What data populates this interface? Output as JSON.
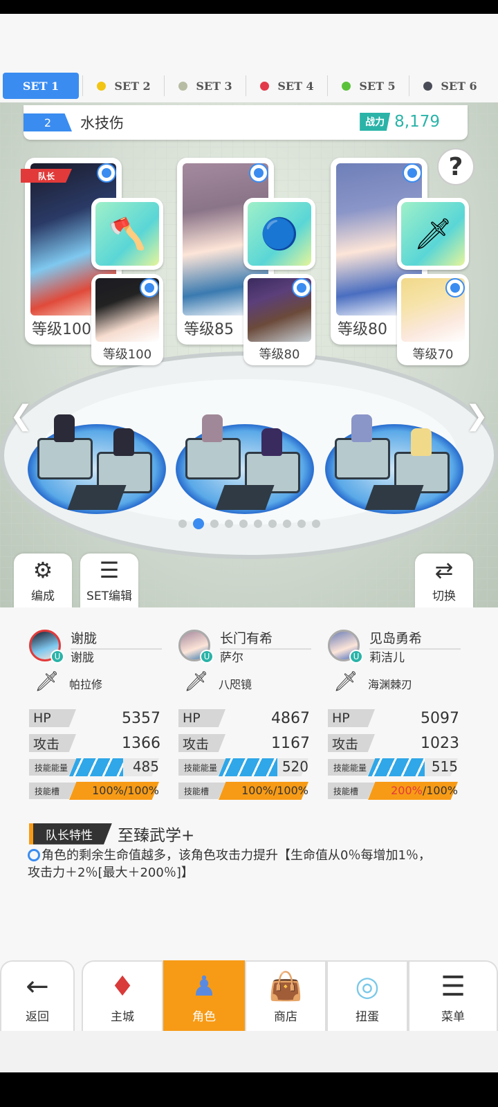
{
  "tabs": [
    {
      "label": "SET 1",
      "dot": null,
      "active": true
    },
    {
      "label": "SET 2",
      "dot": "#f2c414",
      "active": false
    },
    {
      "label": "SET 3",
      "dot": "#b7bca4",
      "active": false
    },
    {
      "label": "SET 4",
      "dot": "#e23a4a",
      "active": false
    },
    {
      "label": "SET 5",
      "dot": "#5ac23a",
      "active": false
    },
    {
      "label": "SET 6",
      "dot": "#4a4d58",
      "active": false
    }
  ],
  "team": {
    "number": "2",
    "name": "水技伤",
    "power_label": "战力",
    "power_value": "8,179"
  },
  "help": "?",
  "leader_tag": "队长",
  "cards": [
    {
      "level": "等级100",
      "sub_level": "等级100"
    },
    {
      "level": "等级85",
      "sub_level": "等级80"
    },
    {
      "level": "等级80",
      "sub_level": "等级70"
    }
  ],
  "page_dots": {
    "count": 10,
    "active": 1
  },
  "side_buttons": {
    "formation": "编成",
    "set_edit": "SET编辑",
    "switch": "切换"
  },
  "characters": [
    {
      "name": "谢胧",
      "support": "谢胧",
      "weapon": "帕拉修",
      "hp_label": "HP",
      "hp": "5357",
      "atk_label": "攻击",
      "atk": "1366",
      "energy_label": "技能能量",
      "energy": "485",
      "slot_label": "技能槽",
      "slot_current": "100",
      "slot_max": "100",
      "slot_fill": 1.0,
      "energy_fill": 0.6
    },
    {
      "name": "长门有希",
      "support": "萨尔",
      "weapon": "八咫镜",
      "hp_label": "HP",
      "hp": "4867",
      "atk_label": "攻击",
      "atk": "1167",
      "energy_label": "技能能量",
      "energy": "520",
      "slot_label": "技能槽",
      "slot_current": "100",
      "slot_max": "100",
      "slot_fill": 1.0,
      "energy_fill": 0.65
    },
    {
      "name": "见岛勇希",
      "support": "莉洁儿",
      "weapon": "海渊棘刃",
      "hp_label": "HP",
      "hp": "5097",
      "atk_label": "攻击",
      "atk": "1023",
      "energy_label": "技能能量",
      "energy": "515",
      "slot_label": "技能槽",
      "slot_current": "200",
      "slot_max": "100",
      "slot_fill": 1.0,
      "energy_fill": 0.63
    }
  ],
  "percent_sign": "%",
  "slash": "/",
  "leader_trait": {
    "label": "队长特性",
    "name": "至臻武学+",
    "description": "角色的剩余生命值越多，该角色攻击力提升【生命值从0％每增加1％，攻击力＋2％[最大＋200％]】"
  },
  "nav": [
    {
      "label": "返回",
      "icon": "back-arrow-icon"
    },
    {
      "label": "主城",
      "icon": "castle-icon"
    },
    {
      "label": "角色",
      "icon": "character-icon",
      "active": true
    },
    {
      "label": "商店",
      "icon": "shop-icon"
    },
    {
      "label": "扭蛋",
      "icon": "gacha-icon"
    },
    {
      "label": "菜单",
      "icon": "menu-icon"
    }
  ],
  "colors": {
    "accent_blue": "#3a8cf0",
    "accent_orange": "#f79b16",
    "teal": "#2bb3a8",
    "leader_red": "#e23a3a"
  }
}
